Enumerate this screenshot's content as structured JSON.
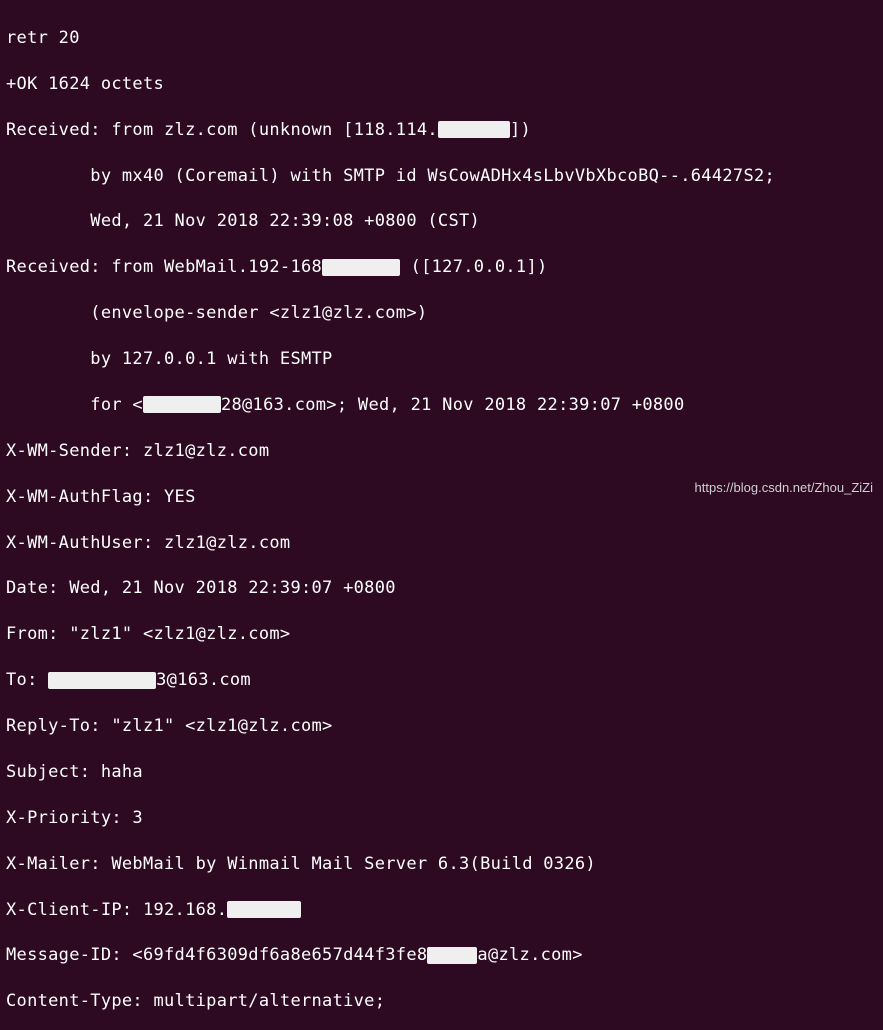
{
  "terminal": {
    "l01": "retr 20",
    "l02": "+OK 1624 octets",
    "l03a": "Received: from zlz.com (unknown [118.114.",
    "l03b": "])",
    "l04": "        by mx40 (Coremail) with SMTP id WsCowADHx4sLbvVbXbcoBQ--.64427S2;",
    "l05": "        Wed, 21 Nov 2018 22:39:08 +0800 (CST)",
    "l06a": "Received: from WebMail.192-168",
    "l06b": " ([127.0.0.1])",
    "l07": "        (envelope-sender <zlz1@zlz.com>)",
    "l08": "        by 127.0.0.1 with ESMTP",
    "l09a": "        for <",
    "l09b": "28@163.com>; Wed, 21 Nov 2018 22:39:07 +0800",
    "l10": "X-WM-Sender: zlz1@zlz.com",
    "l11": "X-WM-AuthFlag: YES",
    "l12": "X-WM-AuthUser: zlz1@zlz.com",
    "l13": "Date: Wed, 21 Nov 2018 22:39:07 +0800",
    "l14": "From: \"zlz1\" <zlz1@zlz.com>",
    "l15a": "To: ",
    "l15b": "3@163.com",
    "l16": "Reply-To: \"zlz1\" <zlz1@zlz.com>",
    "l17": "Subject: haha",
    "l18": "X-Priority: 3",
    "l19": "X-Mailer: WebMail by Winmail Mail Server 6.3(Build 0326)",
    "l20a": "X-Client-IP: 192.168.",
    "l21a": "Message-ID: <69fd4f6309df6a8e657d44f3fe8",
    "l21b": "a@zlz.com>",
    "l22": "Content-Type: multipart/alternative;"
  },
  "watermark": "https://blog.csdn.net/Zhou_ZiZi"
}
